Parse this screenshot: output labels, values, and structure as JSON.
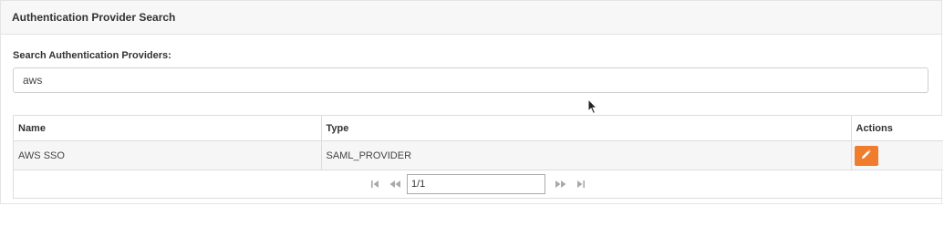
{
  "panel": {
    "title": "Authentication Provider Search"
  },
  "search": {
    "label": "Search Authentication Providers:",
    "value": "aws"
  },
  "table": {
    "columns": [
      "Name",
      "Type",
      "Actions"
    ],
    "rows": [
      {
        "name": "AWS SSO",
        "type": "SAML_PROVIDER"
      }
    ],
    "action_color": "#f07c2e"
  },
  "pagination": {
    "page_value": "1/1",
    "icons": [
      "first-page-icon",
      "previous-page-icon",
      "next-page-icon",
      "last-page-icon"
    ]
  }
}
